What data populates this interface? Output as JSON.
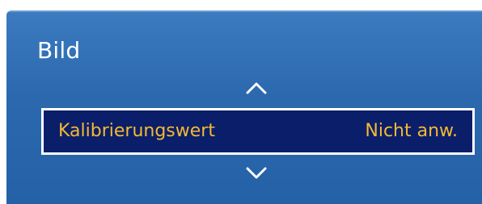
{
  "menu": {
    "title": "Bild",
    "item": {
      "label": "Kalibrierungswert",
      "value": "Nicht anw."
    },
    "scroll_up_icon": "chevron-up-icon",
    "scroll_down_icon": "chevron-down-icon"
  },
  "colors": {
    "panel_blue": "#2c68ad",
    "highlight_bg": "#0b1e6a",
    "highlight_text": "#f5b932",
    "title_text": "#ffffff"
  }
}
